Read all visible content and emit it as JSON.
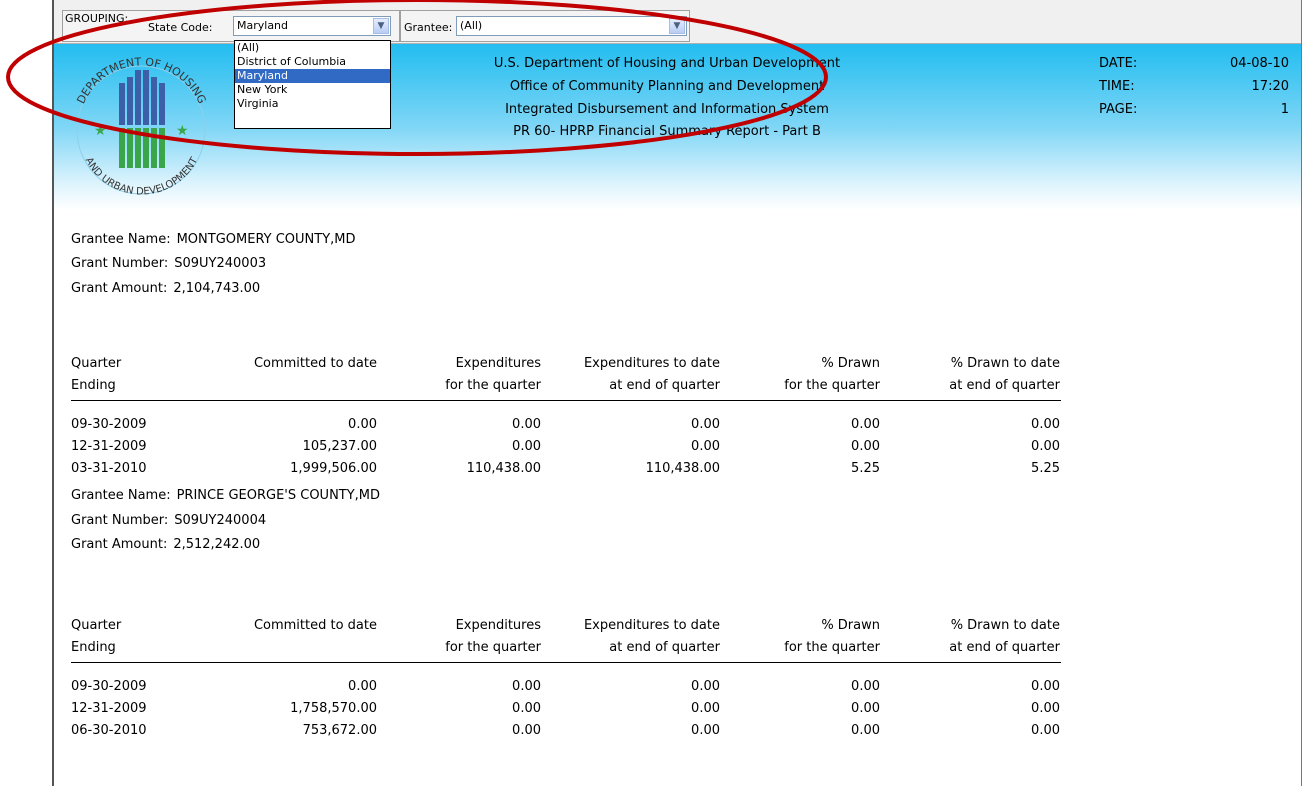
{
  "toolbar": {
    "grouping_label": "GROUPING:",
    "state_label": "State Code:",
    "state_value": "Maryland",
    "grantee_label": "Grantee:",
    "grantee_value": "(All)"
  },
  "state_dropdown": {
    "options": [
      "(All)",
      "District of Columbia",
      "Maryland",
      "New York",
      "Virginia"
    ],
    "selected": "Maryland"
  },
  "report_header": {
    "line1": "U.S. Department of Housing and Urban Development",
    "line2": "Office of Community Planning and Development",
    "line3": "Integrated Disbursement and Information System",
    "line4": "PR 60-  HPRP Financial Summary Report - Part B",
    "date_label": "DATE:",
    "date_value": "04-08-10",
    "time_label": "TIME:",
    "time_value": "17:20",
    "page_label": "PAGE:",
    "page_value": "1"
  },
  "seal": {
    "top_text": "DEPARTMENT OF HOUSING",
    "bottom_text": "AND URBAN DEVELOPMENT"
  },
  "columns": {
    "c1a": "Quarter",
    "c1b": "Ending",
    "c2a": "Committed to date",
    "c2b": "",
    "c3a": "Expenditures",
    "c3b": "for the quarter",
    "c4a": "Expenditures to date",
    "c4b": "at end of quarter",
    "c5a": "% Drawn",
    "c5b": "for the quarter",
    "c6a": "% Drawn to date",
    "c6b": "at end of quarter"
  },
  "labels": {
    "grantee_name": "Grantee Name:",
    "grant_number": "Grant Number:",
    "grant_amount": "Grant Amount:"
  },
  "grantees": [
    {
      "name": "MONTGOMERY COUNTY,MD",
      "number": "S09UY240003",
      "amount": "2,104,743.00",
      "rows": [
        [
          "09-30-2009",
          "0.00",
          "0.00",
          "0.00",
          "0.00",
          "0.00"
        ],
        [
          "12-31-2009",
          "105,237.00",
          "0.00",
          "0.00",
          "0.00",
          "0.00"
        ],
        [
          "03-31-2010",
          "1,999,506.00",
          "110,438.00",
          "110,438.00",
          "5.25",
          "5.25"
        ]
      ]
    },
    {
      "name": "PRINCE GEORGE'S COUNTY,MD",
      "number": "S09UY240004",
      "amount": "2,512,242.00",
      "rows": [
        [
          "09-30-2009",
          "0.00",
          "0.00",
          "0.00",
          "0.00",
          "0.00"
        ],
        [
          "12-31-2009",
          "1,758,570.00",
          "0.00",
          "0.00",
          "0.00",
          "0.00"
        ],
        [
          "06-30-2010",
          "753,672.00",
          "0.00",
          "0.00",
          "0.00",
          "0.00"
        ]
      ]
    }
  ],
  "colors": {
    "annotation": "#c00000",
    "header_band_top": "#22bdf0",
    "selection": "#316ac5"
  }
}
